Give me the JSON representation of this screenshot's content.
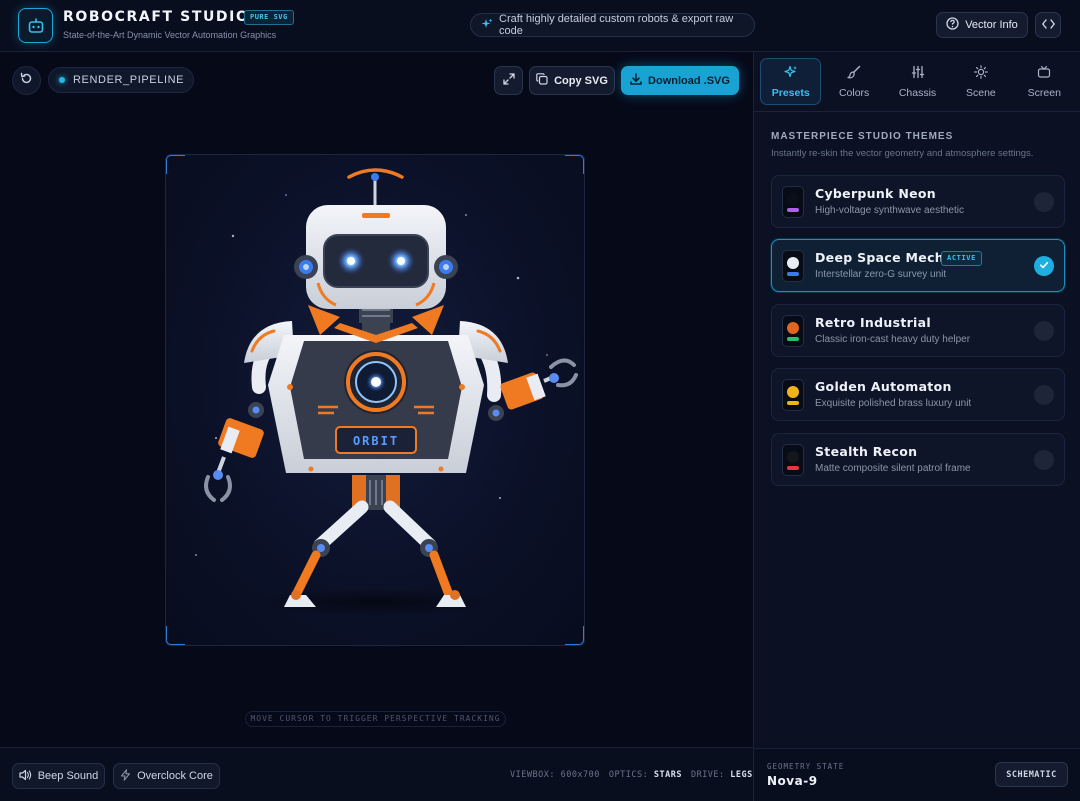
{
  "header": {
    "brand": "ROBOCRAFT STUDIO",
    "badge": "PURE SVG",
    "subtitle": "State-of-the-Art Dynamic Vector Automation Graphics",
    "tagline": "Craft highly detailed custom robots & export raw code",
    "vector_info": "Vector Info"
  },
  "toolbar": {
    "pipeline": "RENDER_PIPELINE",
    "copy": "Copy SVG",
    "download": "Download .SVG"
  },
  "robot": {
    "chest_label": "ORBIT"
  },
  "hint": "MOVE CURSOR TO TRIGGER PERSPECTIVE TRACKING",
  "footer": {
    "beep": "Beep Sound",
    "overclock": "Overclock Core",
    "viewbox_label": "VIEWBOX:",
    "viewbox_value": "600x700",
    "optics_label": "OPTICS:",
    "optics_value": "STARS",
    "drive_label": "DRIVE:",
    "drive_value": "LEGS"
  },
  "tabs": [
    {
      "label": "Presets",
      "icon": "sparkles-icon",
      "active": true
    },
    {
      "label": "Colors",
      "icon": "brush-icon",
      "active": false
    },
    {
      "label": "Chassis",
      "icon": "sliders-icon",
      "active": false
    },
    {
      "label": "Scene",
      "icon": "sun-icon",
      "active": false
    },
    {
      "label": "Screen",
      "icon": "tv-icon",
      "active": false
    }
  ],
  "themes": {
    "title": "MASTERPIECE STUDIO THEMES",
    "subtitle": "Instantly re-skin the vector geometry and atmosphere settings.",
    "active_badge": "ACTIVE",
    "items": [
      {
        "name": "Cyberpunk Neon",
        "desc": "High-voltage synthwave aesthetic",
        "top": "#0c0f1a",
        "bottom": "#b05ef0",
        "active": false
      },
      {
        "name": "Deep Space Mech",
        "desc": "Interstellar zero-G survey unit",
        "top": "#e8ecf4",
        "bottom": "#3a7bf0",
        "active": true
      },
      {
        "name": "Retro Industrial",
        "desc": "Classic iron-cast heavy duty helper",
        "top": "#e0661f",
        "bottom": "#22c36a",
        "active": false
      },
      {
        "name": "Golden Automaton",
        "desc": "Exquisite polished brass luxury unit",
        "top": "#f0b41a",
        "bottom": "#f0b41a",
        "active": false
      },
      {
        "name": "Stealth Recon",
        "desc": "Matte composite silent patrol frame",
        "top": "#14161c",
        "bottom": "#e8353f",
        "active": false
      }
    ]
  },
  "geometry": {
    "label": "GEOMETRY STATE",
    "value": "Nova-9",
    "schematic": "SCHEMATIC"
  },
  "colors": {
    "accent": "#19a2d4",
    "orange": "#f07a22",
    "body_white": "#e9edf3",
    "dark_panel": "#2f3544"
  }
}
